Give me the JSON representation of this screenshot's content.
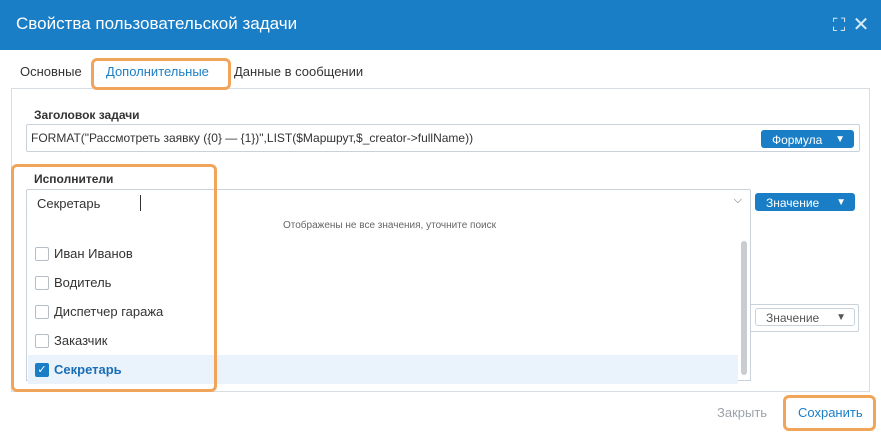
{
  "window": {
    "title": "Свойства пользовательской задачи",
    "expand_icon": "⛶",
    "close_icon": "✕"
  },
  "tabs": [
    {
      "label": "Основные"
    },
    {
      "label": "Дополнительные",
      "active": true
    },
    {
      "label": "Данные в сообщении"
    }
  ],
  "task_title": {
    "label": "Заголовок задачи",
    "value": "FORMAT(\"Рассмотреть заявку ({0} — {1})\",LIST($Маршрут,$_creator->fullName))",
    "mode": "Формула"
  },
  "executors": {
    "label": "Исполнители",
    "value": "Секретарь",
    "mode": "Значение",
    "dropdown": {
      "note": "Отображены не все значения, уточните поиск",
      "options": [
        {
          "label": "Иван Иванов",
          "checked": false
        },
        {
          "label": "Водитель",
          "checked": false
        },
        {
          "label": "Диспетчер гаража",
          "checked": false
        },
        {
          "label": "Заказчик",
          "checked": false
        },
        {
          "label": "Секретарь",
          "checked": true
        }
      ]
    }
  },
  "second_field": {
    "mode": "Значение"
  },
  "footer": {
    "close_label": "Закрыть",
    "save_label": "Сохранить"
  },
  "colors": {
    "accent": "#1a7ec6",
    "highlight": "#f0a55a"
  }
}
